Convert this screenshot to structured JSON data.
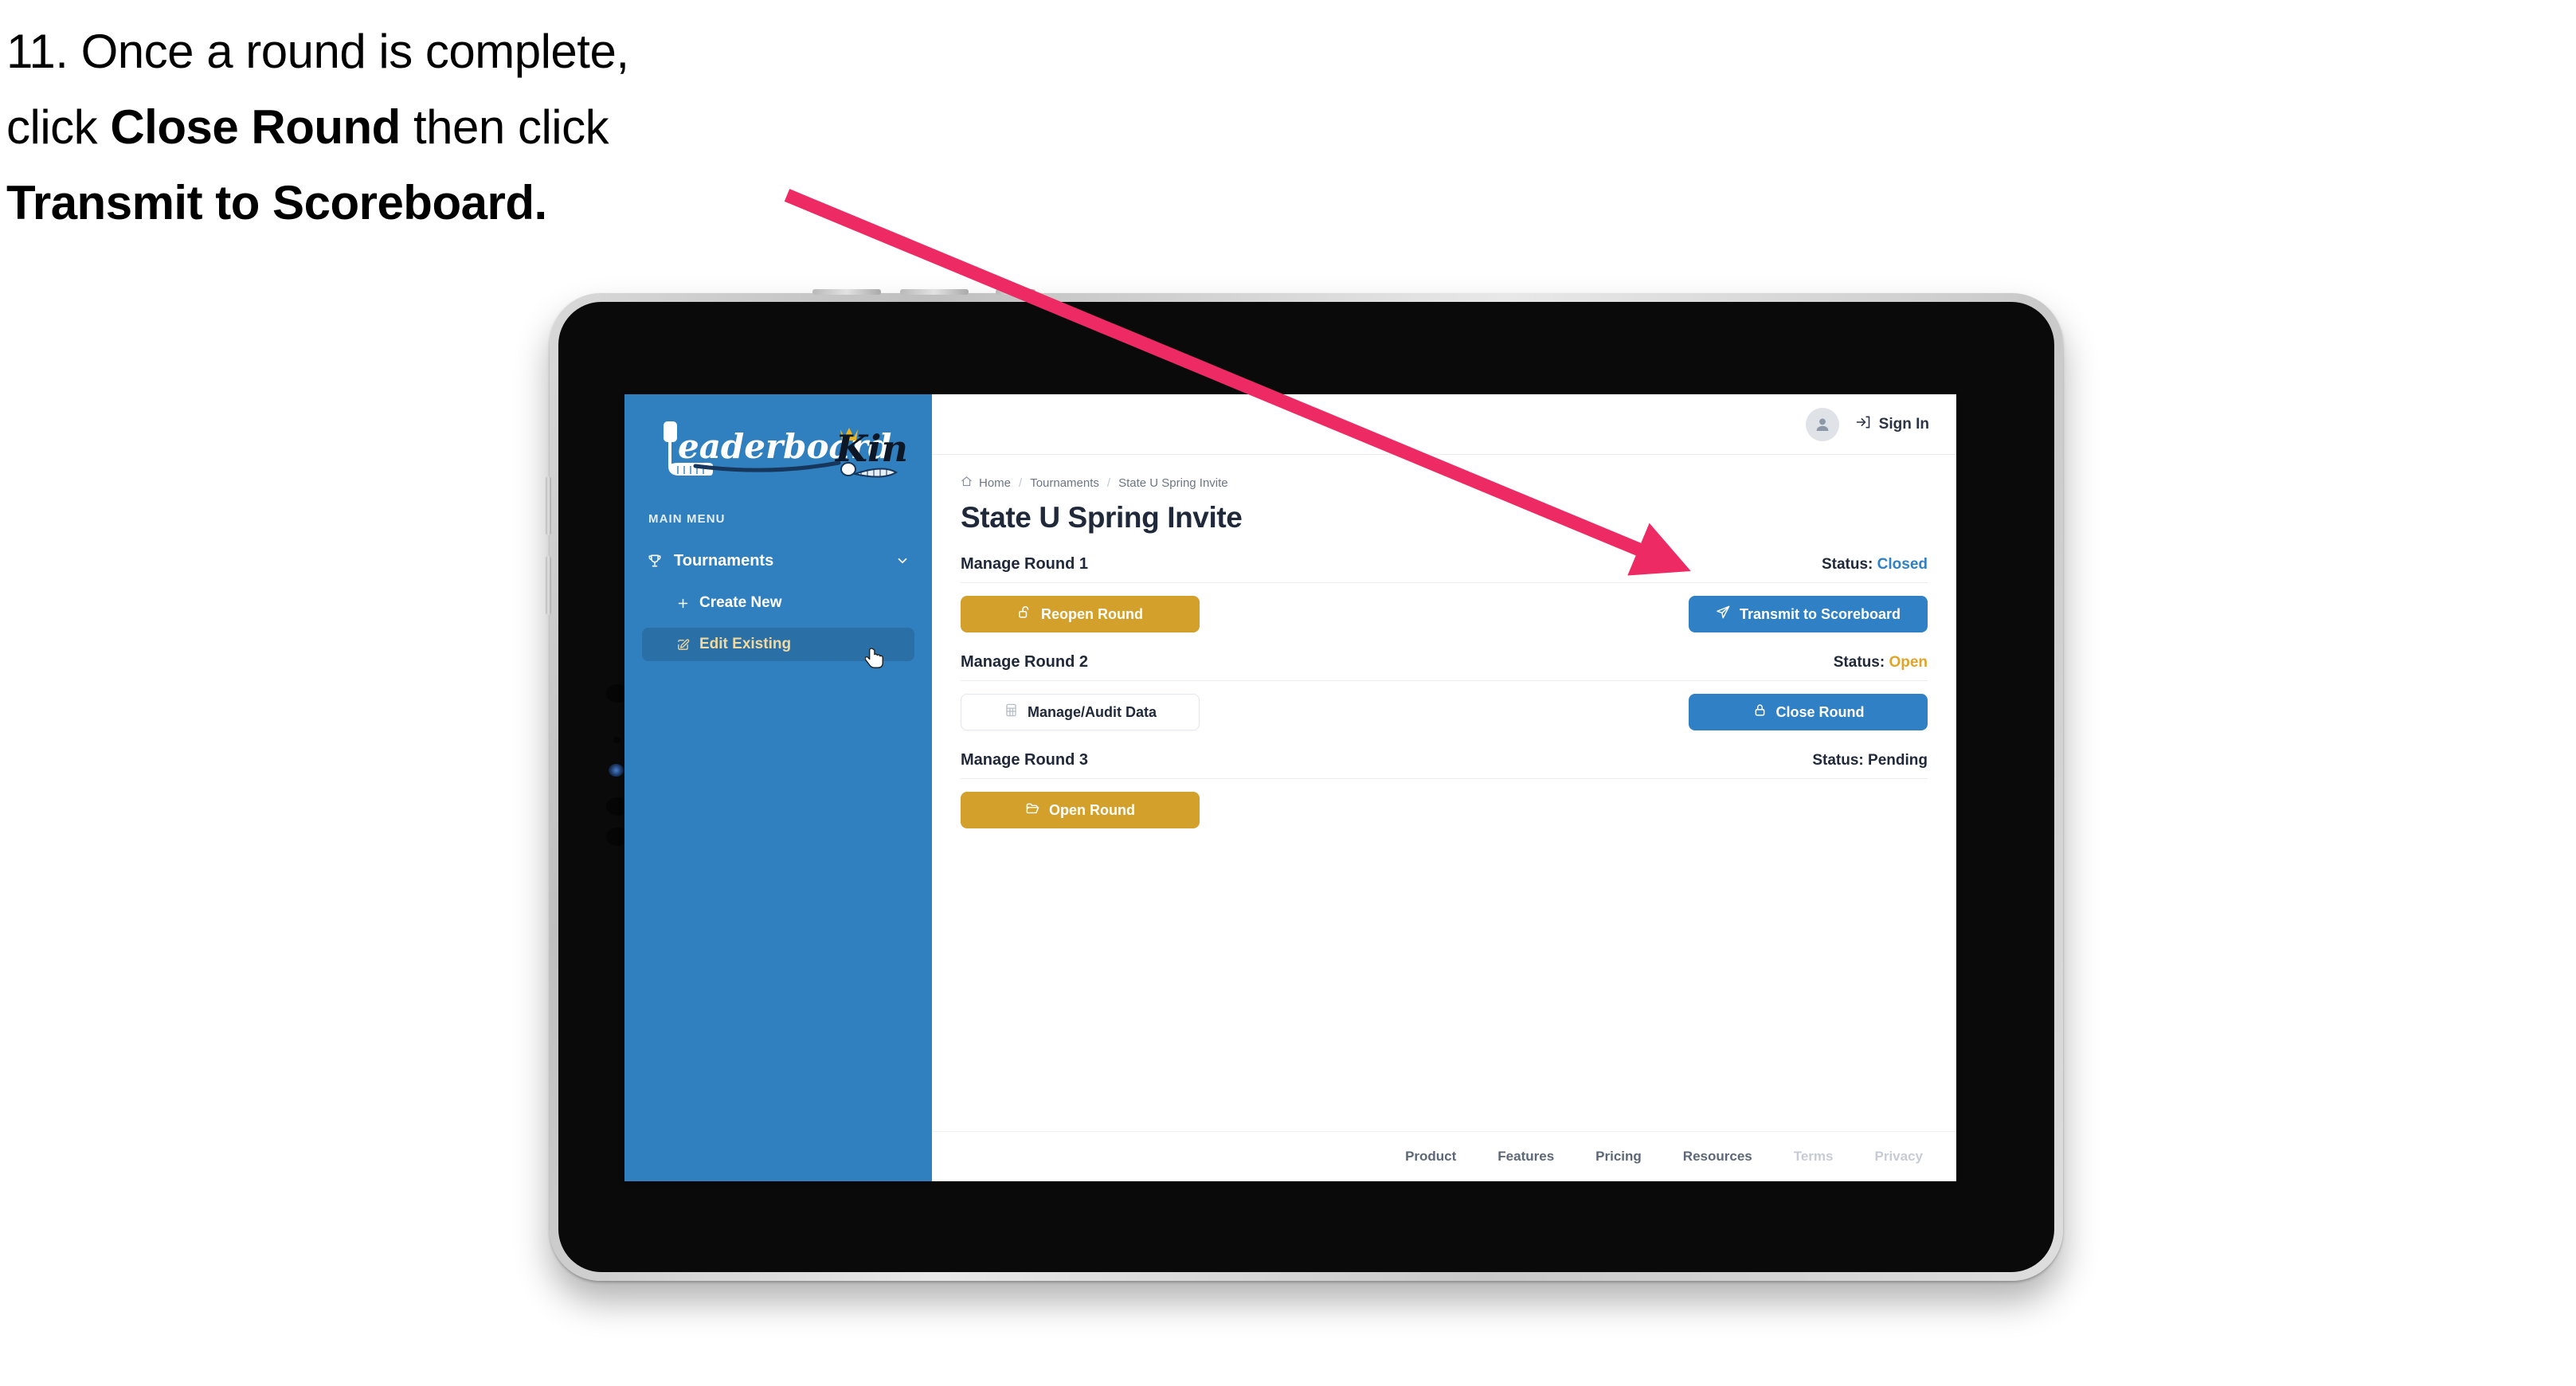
{
  "annotation": {
    "step_number": "11.",
    "line1_pre": "11. Once a round is complete,",
    "line2_pre": "click ",
    "line2_bold": "Close Round",
    "line2_post": " then click",
    "line3_bold": "Transmit to Scoreboard.",
    "arrow_color": "#ED2A63"
  },
  "sidebar": {
    "logo_primary": "Leaderboard",
    "logo_secondary": "King",
    "menu_label": "MAIN MENU",
    "items": [
      {
        "label": "Tournaments",
        "icon": "trophy-icon",
        "chevron": "chevron-down-icon"
      },
      {
        "label": "Create New",
        "icon": "plus-icon",
        "active": false
      },
      {
        "label": "Edit Existing",
        "icon": "pencil-square-icon",
        "active": true
      }
    ],
    "bg_color": "#3080BF",
    "active_bg_color": "#2A6FA6",
    "active_text_color": "#F0D9A0"
  },
  "topbar": {
    "avatar_icon": "user-avatar-icon",
    "signin_icon": "sign-in-icon",
    "signin_label": "Sign In"
  },
  "breadcrumb": {
    "home_icon": "home-icon",
    "items": [
      "Home",
      "Tournaments",
      "State U Spring Invite"
    ],
    "separator": "/"
  },
  "page": {
    "title": "State U Spring Invite"
  },
  "rounds": [
    {
      "title": "Manage Round 1",
      "status_label": "Status:",
      "status_value": "Closed",
      "status_color": "#2F80C4",
      "left_button": {
        "label": "Reopen Round",
        "icon": "unlock-icon",
        "style": "gold"
      },
      "right_button": {
        "label": "Transmit to Scoreboard",
        "icon": "paper-plane-icon",
        "style": "blue"
      }
    },
    {
      "title": "Manage Round 2",
      "status_label": "Status:",
      "status_value": "Open",
      "status_color": "#E0A528",
      "left_button": {
        "label": "Manage/Audit Data",
        "icon": "table-grid-icon",
        "style": "ghost"
      },
      "right_button": {
        "label": "Close Round",
        "icon": "lock-icon",
        "style": "blue"
      }
    },
    {
      "title": "Manage Round 3",
      "status_label": "Status:",
      "status_value": "Pending",
      "status_color": "#20293A",
      "left_button": {
        "label": "Open Round",
        "icon": "folder-open-icon",
        "style": "gold"
      },
      "right_button": null
    }
  ],
  "footer": {
    "links": [
      {
        "label": "Product",
        "dim": false
      },
      {
        "label": "Features",
        "dim": false
      },
      {
        "label": "Pricing",
        "dim": false
      },
      {
        "label": "Resources",
        "dim": false
      },
      {
        "label": "Terms",
        "dim": true
      },
      {
        "label": "Privacy",
        "dim": true
      }
    ]
  },
  "cursor": {
    "type": "pointing-hand-cursor"
  }
}
